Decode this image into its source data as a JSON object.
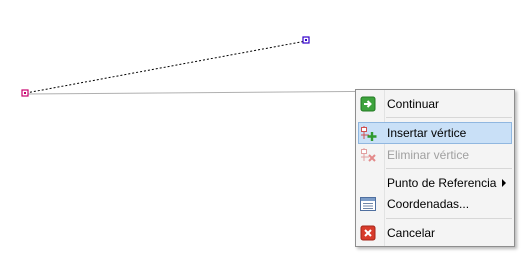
{
  "context_menu": {
    "items": [
      {
        "label": "Continuar",
        "icon": "green-arrow-icon",
        "enabled": true
      },
      {
        "label": "Insertar vértice",
        "icon": "insert-vertex-icon",
        "enabled": true,
        "highlighted": true
      },
      {
        "label": "Eliminar vértice",
        "icon": "delete-vertex-icon",
        "enabled": false
      },
      {
        "label": "Punto de Referencia",
        "icon": "",
        "enabled": true,
        "submenu": true
      },
      {
        "label": "Coordenadas...",
        "icon": "coordinates-table-icon",
        "enabled": true
      },
      {
        "label": "Cancelar",
        "icon": "red-x-icon",
        "enabled": true
      }
    ]
  },
  "colors": {
    "highlight": "#c9e0f7",
    "highlight_border": "#90b7e0",
    "vertex_start": "#c8006e",
    "vertex_end": "#3300cc",
    "segment": "#000000",
    "baseline": "#a0a0a0"
  }
}
